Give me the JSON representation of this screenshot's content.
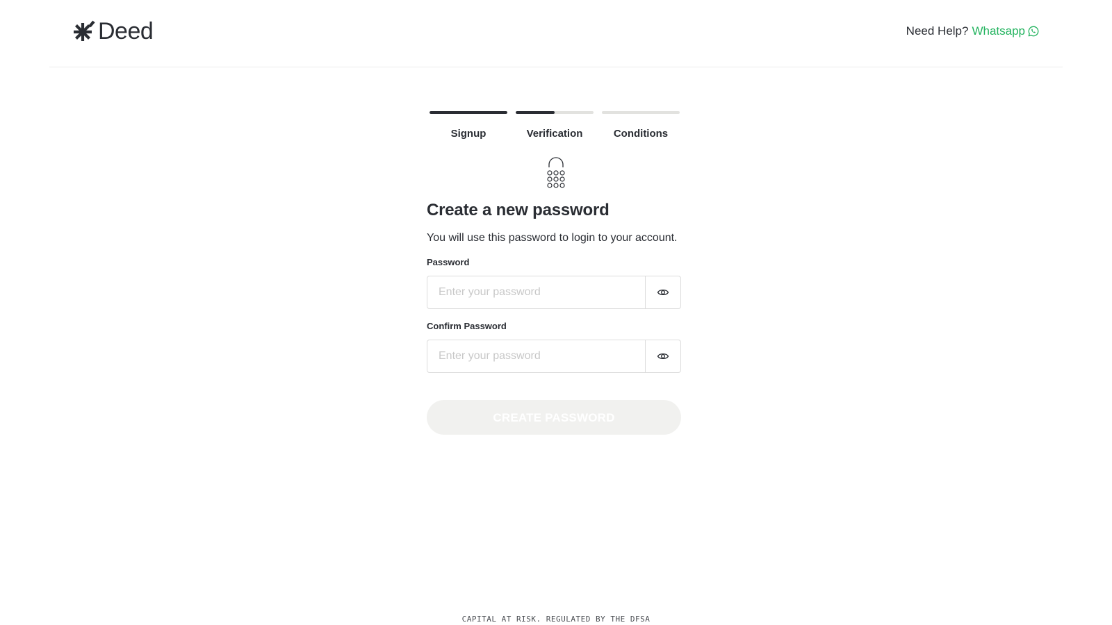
{
  "header": {
    "logo_text": "Deed",
    "logo_icon": "asterisk-logo-icon",
    "help_text": "Need Help?",
    "help_link": "Whatsapp",
    "help_icon": "whatsapp-icon",
    "accent_color": "#22b35e"
  },
  "stepper": {
    "steps": [
      {
        "label": "Signup",
        "progress": 1.0
      },
      {
        "label": "Verification",
        "progress": 0.5
      },
      {
        "label": "Conditions",
        "progress": 0.0
      }
    ]
  },
  "form": {
    "icon": "padlock-keypad-icon",
    "title": "Create a new password",
    "subtitle": "You will use this password to login to your account.",
    "password": {
      "label": "Password",
      "placeholder": "Enter your password",
      "value": "",
      "toggle_icon": "eye-icon"
    },
    "confirm": {
      "label": "Confirm Password",
      "placeholder": "Enter your password",
      "value": "",
      "toggle_icon": "eye-icon"
    },
    "submit_label": "CREATE PASSWORD"
  },
  "footer": {
    "text": "CAPITAL AT RISK. REGULATED BY THE DFSA"
  }
}
